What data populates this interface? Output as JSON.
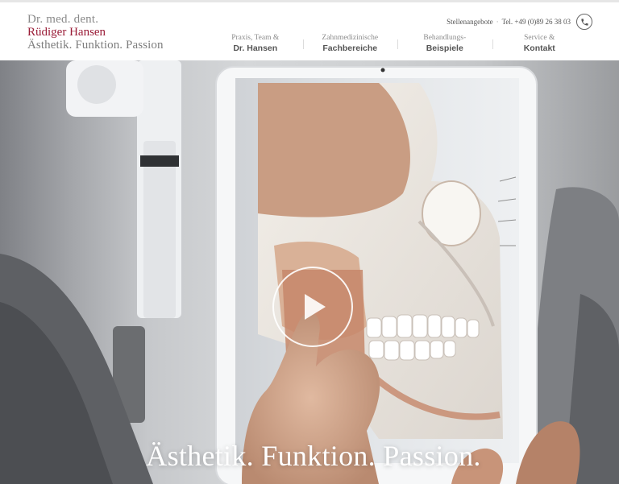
{
  "logo": {
    "line1": "Dr. med. dent.",
    "line2": "Rüdiger Hansen",
    "line3": "Ästhetik. Funktion. Passion"
  },
  "topbar": {
    "jobs": "Stellenangebote",
    "separator": "·",
    "phone": "Tel. +49 (0)89 26 38 03",
    "phone_icon": "phone-icon"
  },
  "nav": [
    {
      "small": "Praxis, Team &",
      "big": "Dr. Hansen"
    },
    {
      "small": "Zahnmedizinische",
      "big": "Fachbereiche"
    },
    {
      "small": "Behandlungs-",
      "big": "Beispiele"
    },
    {
      "small": "Service &",
      "big": "Kontakt"
    }
  ],
  "hero": {
    "title": "Ästhetik. Funktion. Passion.",
    "play_icon": "play-icon"
  },
  "colors": {
    "brand": "#9a1c37",
    "nav_text": "#555555",
    "muted": "#8c8c8c"
  }
}
